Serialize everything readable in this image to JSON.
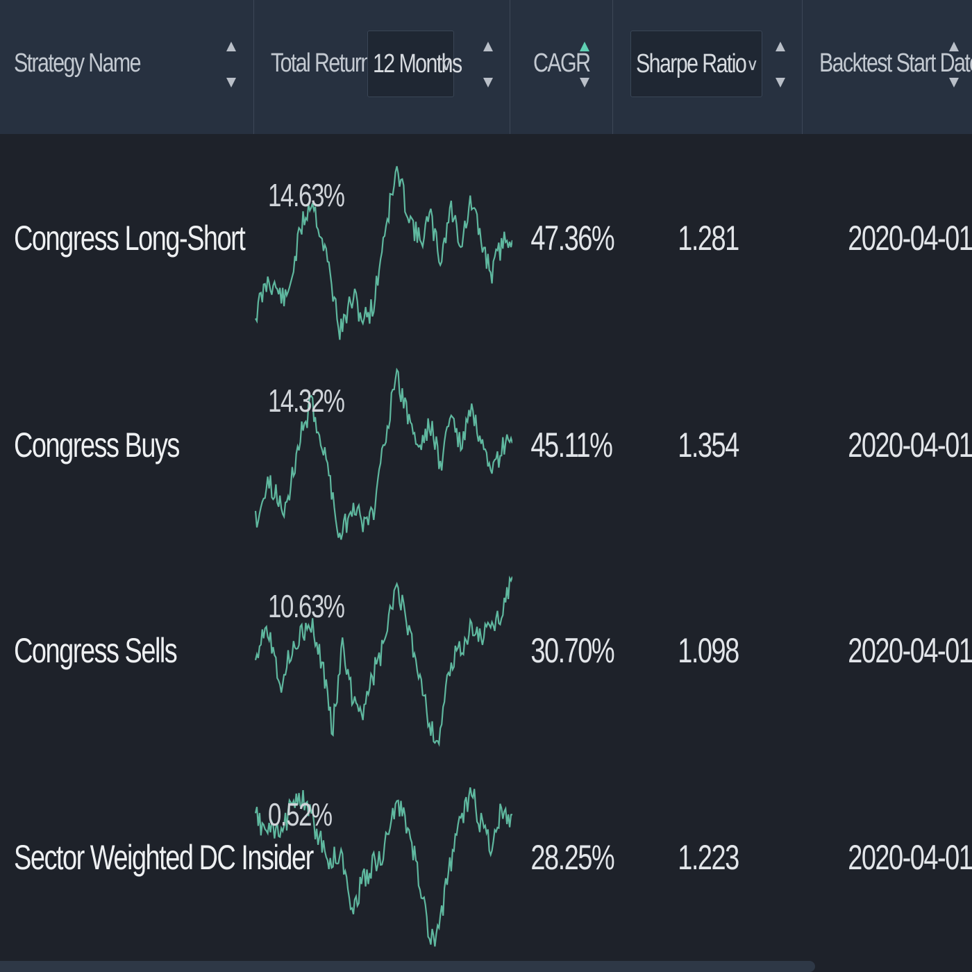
{
  "header": {
    "strategy_name": "Strategy Name",
    "total_return_label": "Total Return:",
    "period_select": "12 Months",
    "cagr": "CAGR",
    "metric_select": "Sharpe Ratio",
    "backtest_start": "Backtest Start Date"
  },
  "colors": {
    "background": "#1e222a",
    "header_bg": "#273140",
    "sparkline": "#5fb89f",
    "sort_active": "#5fd0b4"
  },
  "icons": [
    "sort-arrows-icon",
    "chevron-down-icon"
  ],
  "rows": [
    {
      "name": "Congress Long-Short",
      "total_return": "14.63%",
      "cagr": "47.36%",
      "metric": "1.281",
      "start_date": "2020-04-01"
    },
    {
      "name": "Congress Buys",
      "total_return": "14.32%",
      "cagr": "45.11%",
      "metric": "1.354",
      "start_date": "2020-04-01"
    },
    {
      "name": "Congress Sells",
      "total_return": "10.63%",
      "cagr": "30.70%",
      "metric": "1.098",
      "start_date": "2020-04-01"
    },
    {
      "name": "Sector Weighted DC Insider",
      "total_return": "0.52%",
      "cagr": "28.25%",
      "metric": "1.223",
      "start_date": "2020-04-01"
    }
  ]
}
